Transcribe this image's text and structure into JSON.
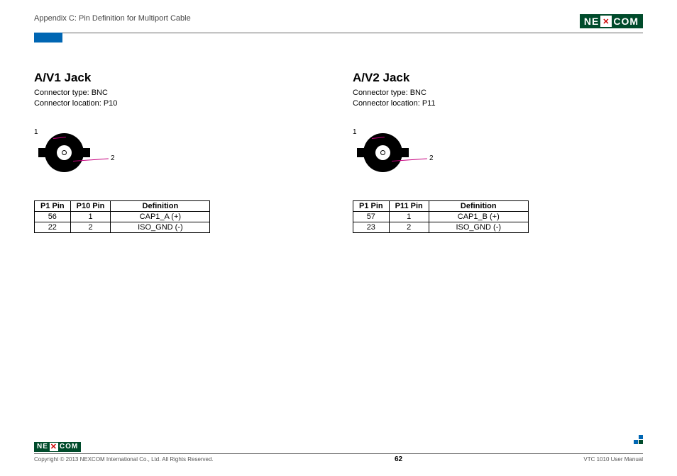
{
  "header": {
    "appendix": "Appendix C: Pin Definition for Multiport Cable",
    "brand_left": "NE",
    "brand_right": "COM"
  },
  "jacks": [
    {
      "title": "A/V1 Jack",
      "connector_type": "Connector type: BNC",
      "connector_location": "Connector location: P10",
      "pin1_label": "1",
      "pin2_label": "2",
      "headers": {
        "c1": "P1 Pin",
        "c2": "P10 Pin",
        "c3": "Definition"
      },
      "rows": [
        {
          "c1": "56",
          "c2": "1",
          "c3": "CAP1_A (+)"
        },
        {
          "c1": "22",
          "c2": "2",
          "c3": "ISO_GND (-)"
        }
      ]
    },
    {
      "title": "A/V2 Jack",
      "connector_type": "Connector type: BNC",
      "connector_location": "Connector location: P11",
      "pin1_label": "1",
      "pin2_label": "2",
      "headers": {
        "c1": "P1 Pin",
        "c2": "P11 Pin",
        "c3": "Definition"
      },
      "rows": [
        {
          "c1": "57",
          "c2": "1",
          "c3": "CAP1_B (+)"
        },
        {
          "c1": "23",
          "c2": "2",
          "c3": "ISO_GND (-)"
        }
      ]
    }
  ],
  "footer": {
    "copyright": "Copyright © 2013 NEXCOM International Co., Ltd. All Rights Reserved.",
    "page": "62",
    "manual": "VTC 1010 User Manual"
  }
}
